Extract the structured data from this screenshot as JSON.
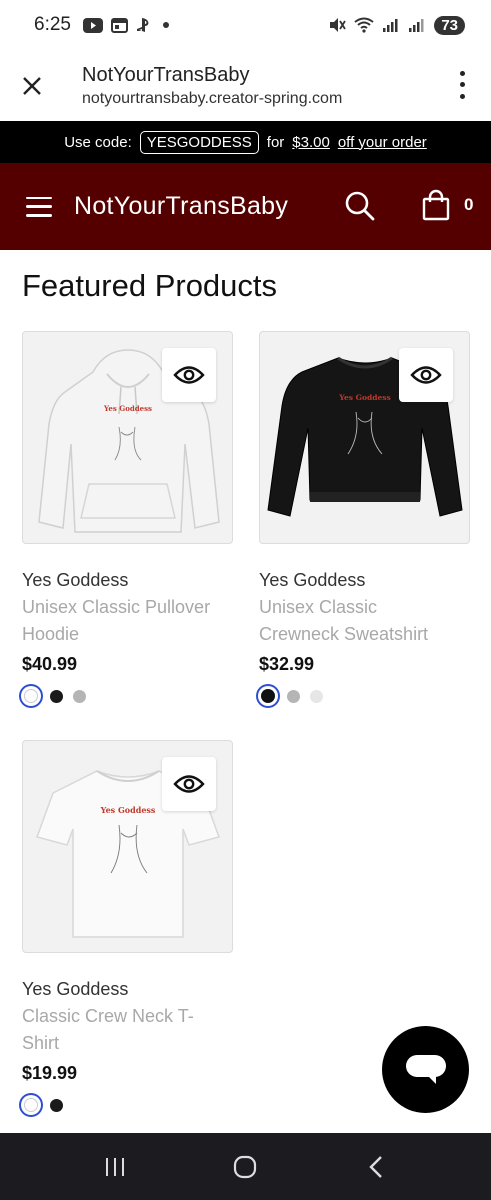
{
  "status_bar": {
    "time": "6:25",
    "battery": "73"
  },
  "browser": {
    "title": "NotYourTransBaby",
    "url": "notyourtransbaby.creator-spring.com"
  },
  "promo": {
    "prefix": "Use code:",
    "code": "YESGODDESS",
    "middle": "for",
    "amount": "$3.00",
    "suffix": "off your order"
  },
  "header": {
    "brand": "NotYourTransBaby",
    "cart_count": "0"
  },
  "section_title": "Featured Products",
  "products": [
    {
      "name": "Yes Goddess",
      "type_line1": "Unisex Classic Pullover",
      "type_line2": "Hoodie",
      "price": "$40.99",
      "print_text": "Yes Goddess",
      "swatches": [
        "#ffffff",
        "#1a1a1a",
        "#b5b5b5"
      ],
      "selected_swatch": 0,
      "garment_color": "#f4f4f4"
    },
    {
      "name": "Yes Goddess",
      "type_line1": "Unisex Classic",
      "type_line2": "Crewneck Sweatshirt",
      "price": "$32.99",
      "print_text": "Yes Goddess",
      "swatches": [
        "#111111",
        "#b5b5b5",
        "#e6e6e6"
      ],
      "selected_swatch": 0,
      "garment_color": "#151515"
    },
    {
      "name": "Yes Goddess",
      "type_line1": "Classic Crew Neck T-",
      "type_line2": "Shirt",
      "price": "$19.99",
      "print_text": "Yes Goddess",
      "swatches": [
        "#ffffff",
        "#1a1a1a"
      ],
      "selected_swatch": 0,
      "garment_color": "#fafafa"
    }
  ],
  "colors": {
    "header_bg": "#540000",
    "promo_bg": "#000000",
    "print_red": "#c0392b",
    "selected_ring": "#2d4fd0"
  }
}
